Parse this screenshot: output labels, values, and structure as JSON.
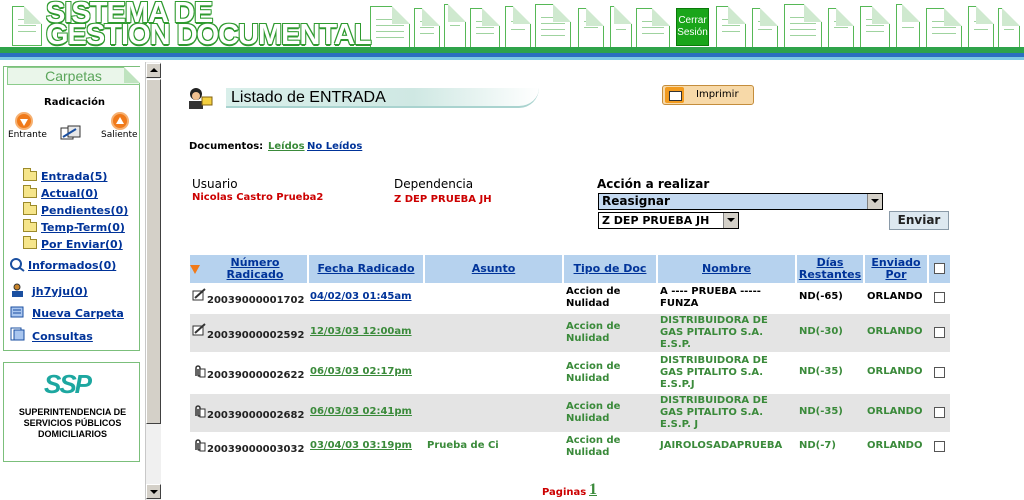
{
  "app": {
    "title_line1": "SISTEMA DE",
    "title_line2": "GESTION DOCUMENTAL",
    "logout_label_1": "Cerrar",
    "logout_label_2": "Sesión",
    "brand_color": "#2ea34a",
    "accent_color": "#2b6fc0"
  },
  "sidebar": {
    "tab_label": "Carpetas",
    "radicacion_label": "Radicación",
    "entrante_label": "Entrante",
    "saliente_label": "Saliente",
    "folders": [
      {
        "label": "Entrada(5)"
      },
      {
        "label": "Actual(0)"
      },
      {
        "label": "Pendientes(0)"
      },
      {
        "label": "Temp-Term(0)"
      },
      {
        "label": "Por Enviar(0)"
      }
    ],
    "informados_label": "Informados(0)",
    "user_folder_label": "jh7yju(0)",
    "nueva_carpeta_label": "Nueva Carpeta",
    "consultas_label": "Consultas",
    "logo_text": "SSP",
    "org_name": "SUPERINTENDENCIA DE SERVICIOS PÚBLICOS DOMICILIARIOS"
  },
  "main": {
    "list_title": "Listado de ENTRADA",
    "print_label": "Imprimir",
    "documents_label": "Documentos:",
    "read_label": "Leídos",
    "unread_label": "No Leídos",
    "user_label": "Usuario",
    "user_value": "Nicolas Castro Prueba2",
    "dependency_label": "Dependencia",
    "dependency_value": "Z DEP PRUEBA JH",
    "action_label": "Acción a realizar",
    "action_selected": "Reasignar",
    "dep_selected": "Z DEP PRUEBA JH",
    "send_label": "Enviar",
    "pages_label": "Paginas",
    "current_page": "1"
  },
  "table": {
    "columns": {
      "numero": "Número Radicado",
      "fecha": "Fecha Radicado",
      "asunto": "Asunto",
      "tipo": "Tipo de Doc",
      "nombre": "Nombre",
      "dias": "Días Restantes",
      "enviado": "Enviado Por"
    },
    "rows": [
      {
        "icon": "edit-note-icon",
        "numero": "20039000001702",
        "fecha": "04/02/03 01:45am",
        "asunto": "",
        "tipo": "Accion de Nulidad",
        "nombre": "A ---- PRUEBA ----- FUNZA",
        "dias": "ND(-65)",
        "enviado": "ORLANDO",
        "read": false
      },
      {
        "icon": "edit-note-icon",
        "numero": "20039000002592",
        "fecha": "12/03/03 12:00am",
        "asunto": "",
        "tipo": "Accion de Nulidad",
        "nombre": "DISTRIBUIDORA DE GAS PITALITO S.A. E.S.P.",
        "dias": "ND(-30)",
        "enviado": "ORLANDO",
        "read": true
      },
      {
        "icon": "paperclip-icon",
        "numero": "20039000002622",
        "fecha": "06/03/03 02:17pm",
        "asunto": "",
        "tipo": "Accion de Nulidad",
        "nombre": "DISTRIBUIDORA DE GAS PITALITO S.A. E.S.P.J",
        "dias": "ND(-35)",
        "enviado": "ORLANDO",
        "read": true
      },
      {
        "icon": "paperclip-icon",
        "numero": "20039000002682",
        "fecha": "06/03/03 02:41pm",
        "asunto": "",
        "tipo": "Accion de Nulidad",
        "nombre": "DISTRIBUIDORA DE GAS PITALITO S.A. E.S.P. J",
        "dias": "ND(-35)",
        "enviado": "ORLANDO",
        "read": true
      },
      {
        "icon": "paperclip-icon",
        "numero": "20039000003032",
        "fecha": "03/04/03 03:19pm",
        "asunto": "Prueba de Ci",
        "tipo": "Accion de Nulidad",
        "nombre": "JAIROLOSADAPRUEBA",
        "dias": "ND(-7)",
        "enviado": "ORLANDO",
        "read": true
      }
    ]
  }
}
